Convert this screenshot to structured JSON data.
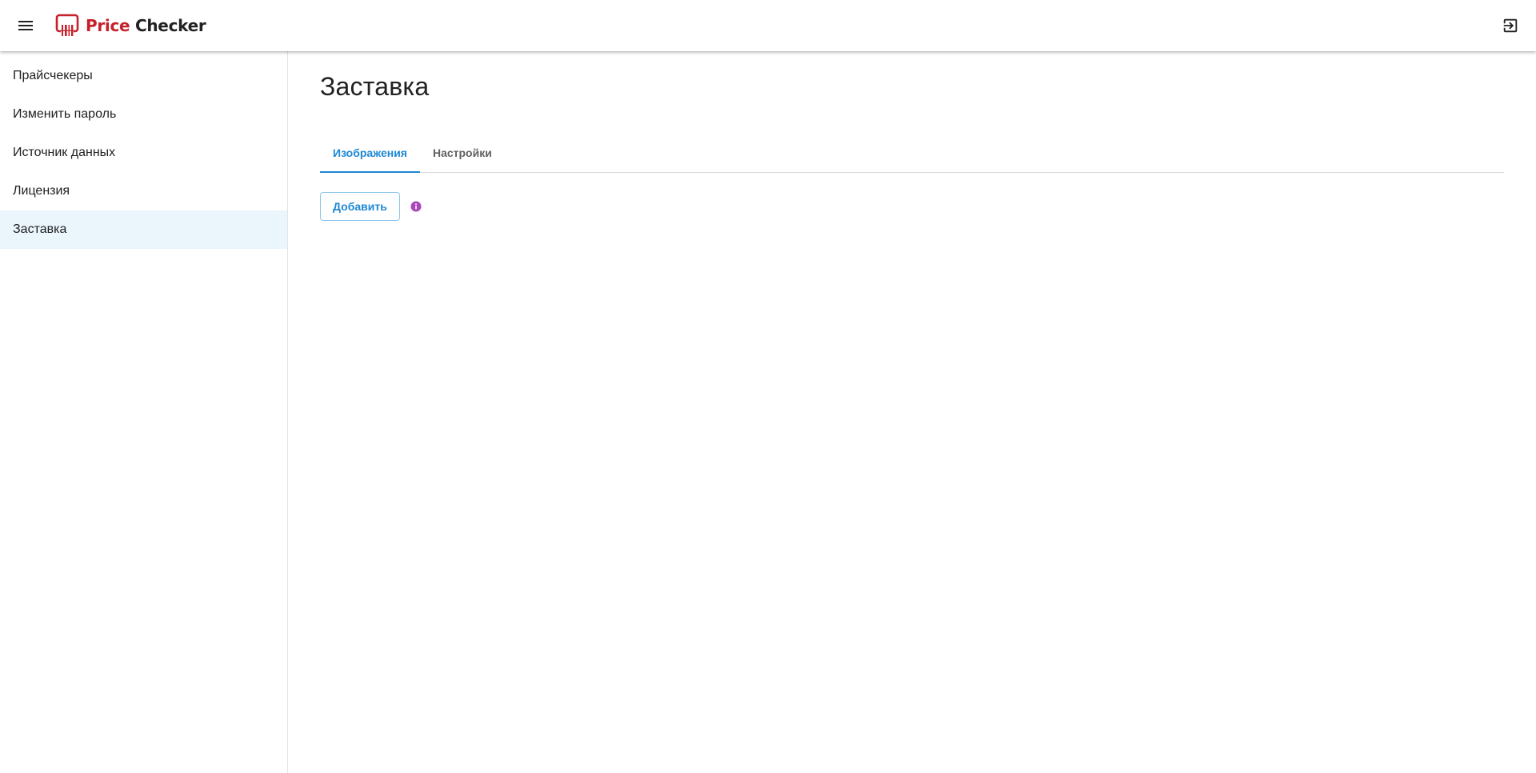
{
  "appbar": {
    "logo": {
      "word1": "Price",
      "word2": "Checker"
    },
    "menu_icon": "menu-icon",
    "logout_icon": "logout-icon"
  },
  "sidebar": {
    "items": [
      {
        "label": "Прайсчекеры"
      },
      {
        "label": "Изменить пароль"
      },
      {
        "label": "Источник данных"
      },
      {
        "label": "Лицензия"
      },
      {
        "label": "Заставка",
        "active": true
      }
    ]
  },
  "main": {
    "title": "Заставка",
    "tabs": [
      {
        "label": "Изображения",
        "active": true
      },
      {
        "label": "Настройки"
      }
    ],
    "add_button": "Добавить",
    "info_icon": "info-icon"
  },
  "colors": {
    "brand_red": "#c6202a",
    "accent_blue": "#1e88d4",
    "active_nav_bg": "#eaf5fc",
    "info_purple": "#ab47bc"
  }
}
